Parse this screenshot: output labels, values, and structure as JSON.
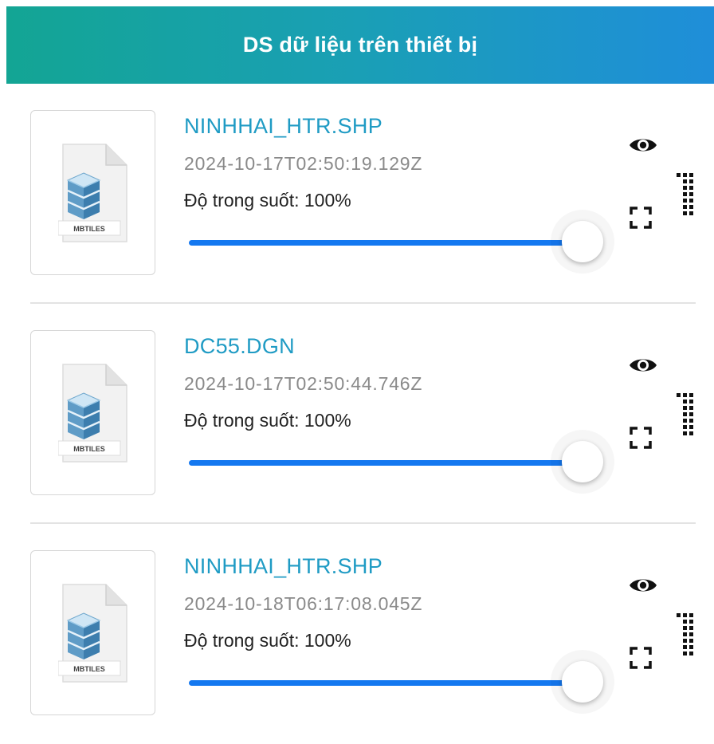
{
  "header": {
    "title": "DS dữ liệu trên thiết bị"
  },
  "colors": {
    "header_gradient_start": "#13a594",
    "header_gradient_end": "#1f8ed9",
    "name_color": "#1f9bc4",
    "slider_color": "#1478f0"
  },
  "file_icon": {
    "label": "MBTILES",
    "icon": "mbtiles-file-icon"
  },
  "items": [
    {
      "name": "NINHHAI_HTR.SHP",
      "timestamp": "2024-10-17T02:50:19.129Z",
      "opacity_label": "Độ trong suốt: 100%",
      "opacity_value": 1.0
    },
    {
      "name": "DC55.DGN",
      "timestamp": "2024-10-17T02:50:44.746Z",
      "opacity_label": "Độ trong suốt: 100%",
      "opacity_value": 1.0
    },
    {
      "name": "NINHHAI_HTR.SHP",
      "timestamp": "2024-10-18T06:17:08.045Z",
      "opacity_label": "Độ trong suốt: 100%",
      "opacity_value": 1.0
    }
  ],
  "icons": {
    "visibility": "eye-icon",
    "zoom_to": "expand-icon",
    "reorder": "drag-handle-icon"
  }
}
